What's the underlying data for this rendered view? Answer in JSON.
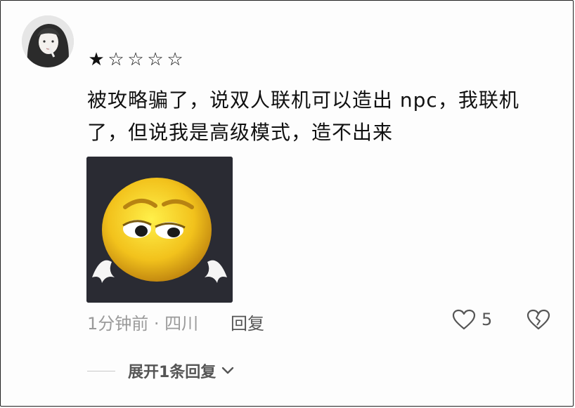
{
  "comment": {
    "rating": {
      "filled": 1,
      "total": 5,
      "filled_char": "★",
      "empty_char": "☆"
    },
    "lines": [
      "被攻略骗了，说双人联机可以造出 npc，我联机",
      "了，但说我是高级模式，造不出来"
    ],
    "meta": "1分钟前 · 四川",
    "reply_label": "回复",
    "like_count": "5",
    "expand_label": "展开1条回复"
  },
  "colors": {
    "face": "#f2c21c",
    "background": "#2a2b33",
    "muted": "#9a9a9a"
  },
  "icons": {
    "like": "heart-outline-icon",
    "dislike": "broken-heart-icon",
    "expand": "chevron-down-icon"
  }
}
